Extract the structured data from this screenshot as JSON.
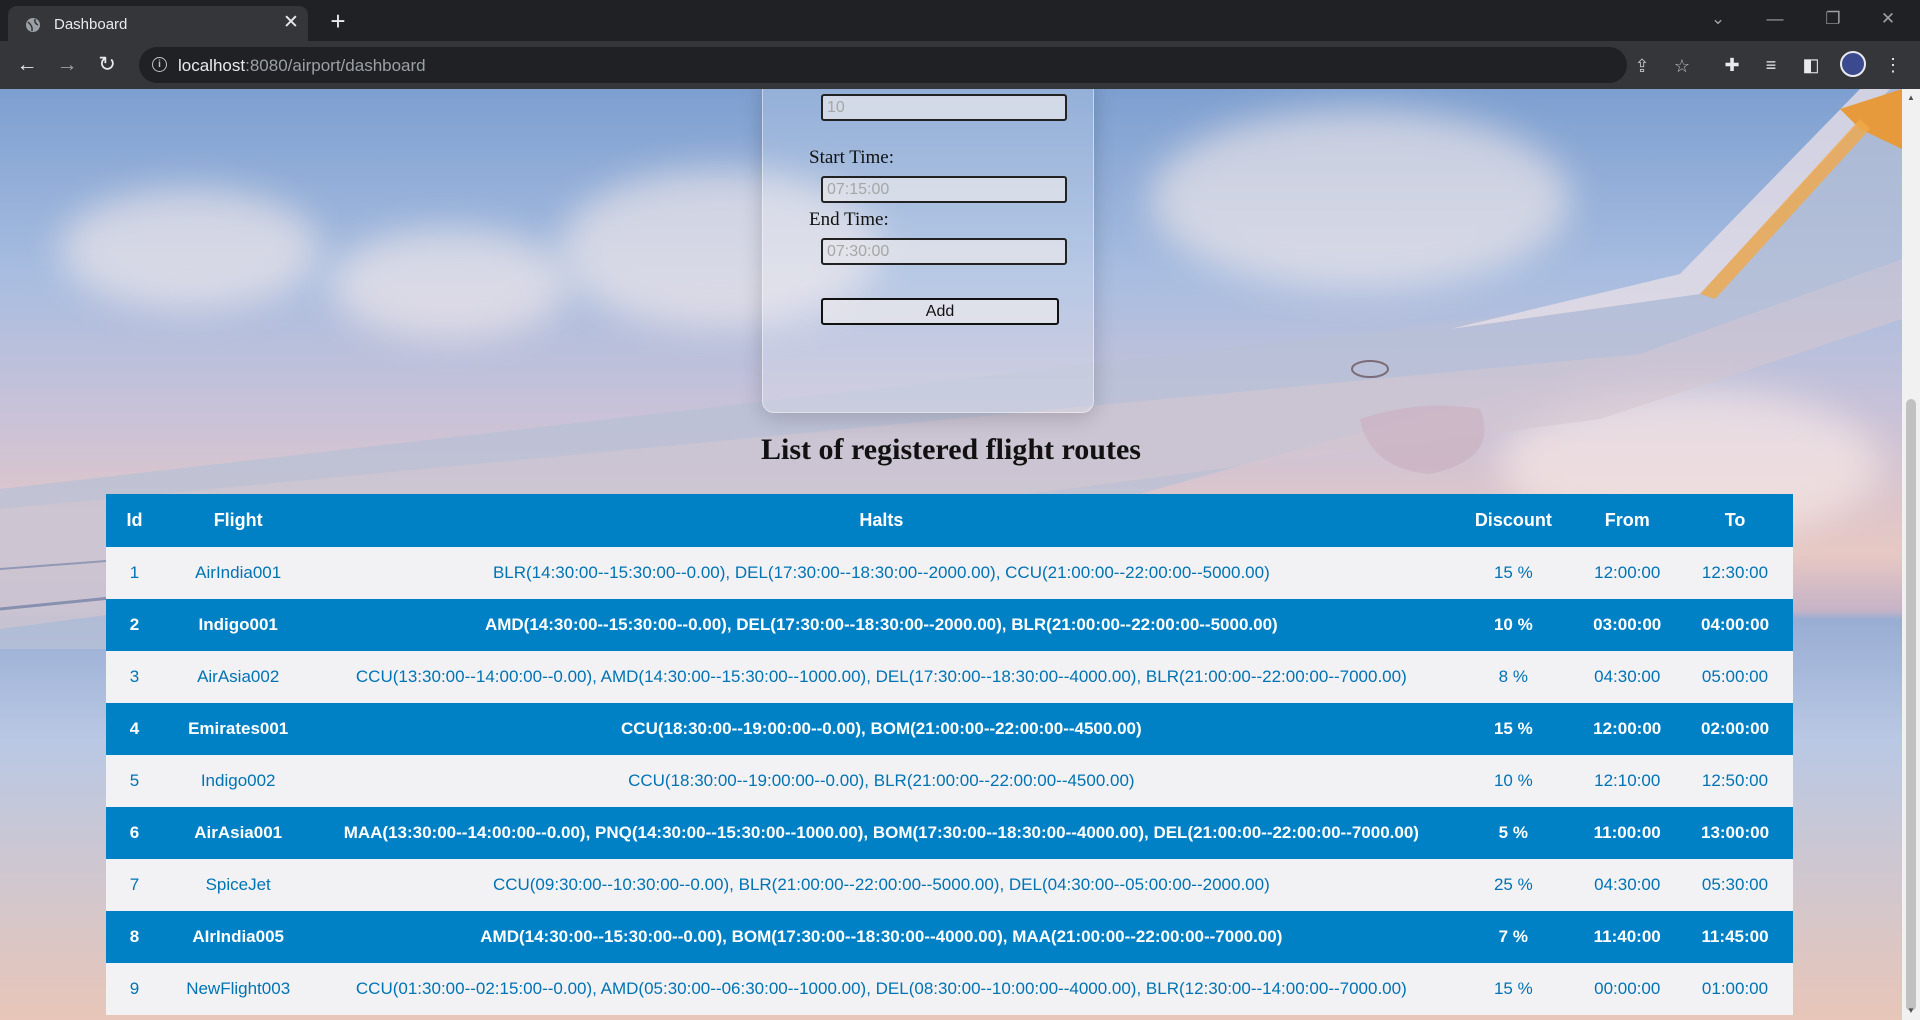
{
  "browser": {
    "tab_title": "Dashboard",
    "url_host": "localhost",
    "url_path": ":8080/airport/dashboard"
  },
  "form": {
    "first_input_value": "10",
    "start_time_label": "Start Time:",
    "start_time_value": "07:15:00",
    "end_time_label": "End Time:",
    "end_time_value": "07:30:00",
    "add_label": "Add"
  },
  "list_title": "List of registered flight routes",
  "table": {
    "headers": [
      "Id",
      "Flight",
      "Halts",
      "Discount",
      "From",
      "To"
    ],
    "rows": [
      [
        "1",
        "AirIndia001",
        "BLR(14:30:00--15:30:00--0.00), DEL(17:30:00--18:30:00--2000.00), CCU(21:00:00--22:00:00--5000.00)",
        "15 %",
        "12:00:00",
        "12:30:00"
      ],
      [
        "2",
        "Indigo001",
        "AMD(14:30:00--15:30:00--0.00), DEL(17:30:00--18:30:00--2000.00), BLR(21:00:00--22:00:00--5000.00)",
        "10 %",
        "03:00:00",
        "04:00:00"
      ],
      [
        "3",
        "AirAsia002",
        "CCU(13:30:00--14:00:00--0.00), AMD(14:30:00--15:30:00--1000.00), DEL(17:30:00--18:30:00--4000.00), BLR(21:00:00--22:00:00--7000.00)",
        "8 %",
        "04:30:00",
        "05:00:00"
      ],
      [
        "4",
        "Emirates001",
        "CCU(18:30:00--19:00:00--0.00), BOM(21:00:00--22:00:00--4500.00)",
        "15 %",
        "12:00:00",
        "02:00:00"
      ],
      [
        "5",
        "Indigo002",
        "CCU(18:30:00--19:00:00--0.00), BLR(21:00:00--22:00:00--4500.00)",
        "10 %",
        "12:10:00",
        "12:50:00"
      ],
      [
        "6",
        "AirAsia001",
        "MAA(13:30:00--14:00:00--0.00), PNQ(14:30:00--15:30:00--1000.00), BOM(17:30:00--18:30:00--4000.00), DEL(21:00:00--22:00:00--7000.00)",
        "5 %",
        "11:00:00",
        "13:00:00"
      ],
      [
        "7",
        "SpiceJet",
        "CCU(09:30:00--10:30:00--0.00), BLR(21:00:00--22:00:00--5000.00), DEL(04:30:00--05:00:00--2000.00)",
        "25 %",
        "04:30:00",
        "05:30:00"
      ],
      [
        "8",
        "AIrIndia005",
        "AMD(14:30:00--15:30:00--0.00), BOM(17:30:00--18:30:00--4000.00), MAA(21:00:00--22:00:00--7000.00)",
        "7 %",
        "11:40:00",
        "11:45:00"
      ],
      [
        "9",
        "NewFlight003",
        "CCU(01:30:00--02:15:00--0.00), AMD(05:30:00--06:30:00--1000.00), DEL(08:30:00--10:00:00--4000.00), BLR(12:30:00--14:00:00--7000.00)",
        "15 %",
        "00:00:00",
        "01:00:00"
      ]
    ]
  },
  "colors": {
    "table_header": "#0081c6",
    "odd_row_bg": "#f2f2f4",
    "odd_row_text": "#0073b3",
    "even_row_bg": "#0081c6"
  },
  "icons": {
    "back": "arrow-left-icon",
    "forward": "arrow-right-icon",
    "reload": "reload-icon",
    "info": "info-icon",
    "share": "share-icon",
    "bookmark": "star-icon",
    "extensions": "puzzle-icon",
    "media": "media-queue-icon",
    "sidepanel": "side-panel-icon",
    "menu": "kebab-menu-icon"
  }
}
